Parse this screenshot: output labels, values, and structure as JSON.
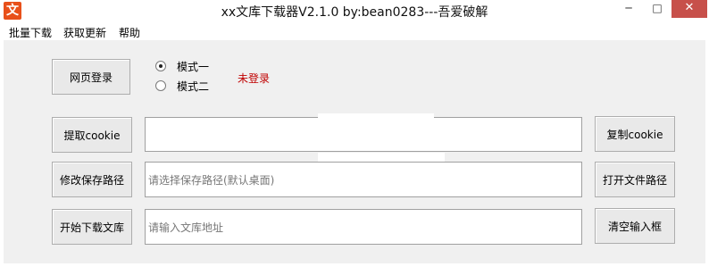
{
  "window": {
    "icon_char": "文",
    "title": "xx文库下载器V2.1.0  by:bean0283---吾爱破解",
    "minimize": "─",
    "maximize": "□",
    "close": "✕"
  },
  "menu": [
    "批量下载",
    "获取更新",
    "帮助"
  ],
  "login": {
    "button": "网页登录",
    "status": "未登录",
    "status_color": "#c00000"
  },
  "modes": [
    {
      "label": "模式一",
      "checked": true
    },
    {
      "label": "模式二",
      "checked": false
    }
  ],
  "cookie": {
    "extract_button": "提取cookie",
    "value": "",
    "copy_button": "复制cookie"
  },
  "save_path": {
    "change_button": "修改保存路径",
    "placeholder": "请选择保存路径(默认桌面)",
    "open_button": "打开文件路径"
  },
  "download": {
    "start_button": "开始下载文库",
    "placeholder": "请输入文库地址",
    "clear_button": "清空输入框"
  }
}
